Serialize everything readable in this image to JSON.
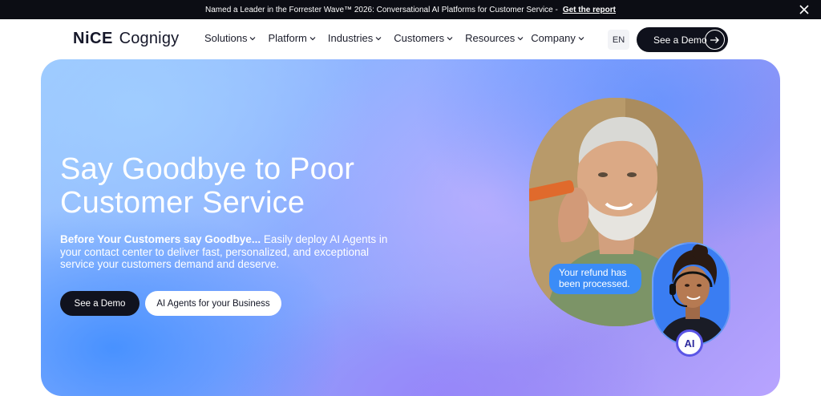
{
  "announcement": {
    "text": "Named a Leader in the Forrester Wave™ 2026: Conversational AI Platforms for Customer Service -",
    "link": "Get the report",
    "close_icon": "close-icon"
  },
  "nav": {
    "logo_nice": "NiCE",
    "logo_product": "Cognigy",
    "items": [
      {
        "label": "Solutions"
      },
      {
        "label": "Platform"
      },
      {
        "label": "Industries"
      },
      {
        "label": "Customers"
      },
      {
        "label": "Resources"
      },
      {
        "label": "Company"
      }
    ],
    "language": "EN",
    "cta": "See a Demo",
    "cta_icon": "arrow-right-icon"
  },
  "hero": {
    "title": "Say Goodbye to Poor Customer Service",
    "subtitle_bold": "Before Your Customers say Goodbye...",
    "subtitle_rest": " Easily deploy AI Agents in your contact center to deliver fast, personalized, and exceptional service your customers demand and deserve.",
    "primary_button": "See a Demo",
    "secondary_button": "AI Agents for your Business",
    "chat_bubble": "Your refund has been processed.",
    "ai_badge": "AI"
  },
  "colors": {
    "dark": "#0f111c",
    "bubble": "#3b8cf7",
    "badge_ring": "#5a55e6"
  }
}
